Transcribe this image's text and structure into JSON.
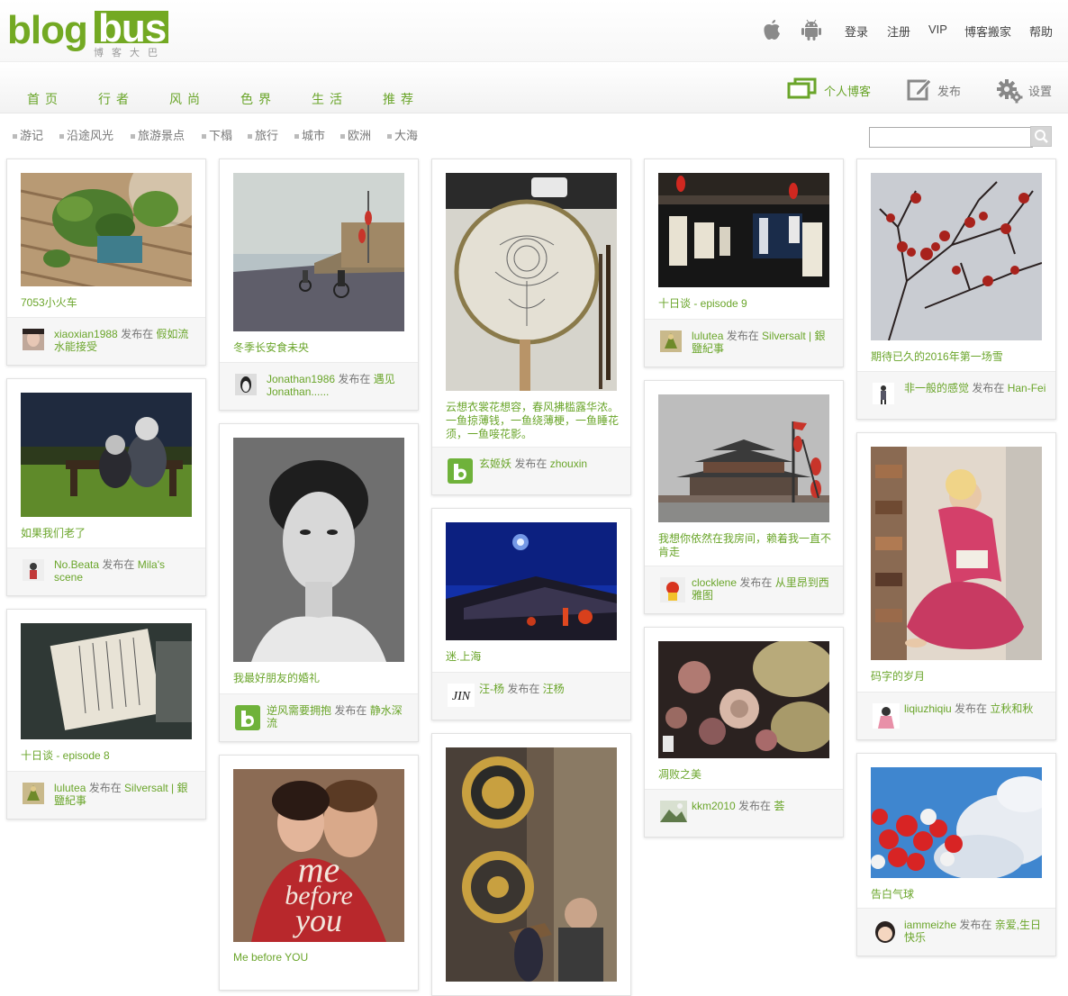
{
  "header": {
    "logo_main": "blog",
    "logo_bus": "bus",
    "logo_sub": "博客大巴",
    "links": [
      "登录",
      "注册",
      "VIP",
      "博客搬家",
      "帮助"
    ],
    "platform_icons": [
      "apple-icon",
      "android-icon"
    ]
  },
  "nav": {
    "items": [
      "首页",
      "行者",
      "风尚",
      "色界",
      "生活",
      "推荐"
    ],
    "tools": [
      {
        "label": "个人博客",
        "icon": "personal-blog-icon"
      },
      {
        "label": "发布",
        "icon": "edit-icon"
      },
      {
        "label": "设置",
        "icon": "gear-icon"
      }
    ]
  },
  "tags": [
    "游记",
    "沿途风光",
    "旅游景点",
    "下榻",
    "旅行",
    "城市",
    "欧洲",
    "大海"
  ],
  "search": {
    "placeholder": "",
    "button_icon": "search-icon"
  },
  "colors": {
    "accent": "#6aa52a",
    "logo": "#73a923"
  },
  "posts": [
    {
      "title": "7053小火车",
      "user": "xiaoxian1988",
      "verb": " 发布在 ",
      "blog": "假如流水能接受"
    },
    {
      "title": "如果我们老了",
      "user": "No.Beata",
      "verb": " 发布在 ",
      "blog": "Mila's scene"
    },
    {
      "title": "十日谈 - episode 8",
      "user": "lulutea",
      "verb": " 发布在 ",
      "blog": "Silversalt | 銀鹽紀事"
    },
    {
      "title": "冬季长安食未央",
      "user": "Jonathan1986",
      "verb": " 发布在 ",
      "blog": "遇见Jonathan......"
    },
    {
      "title": "我最好朋友的婚礼",
      "user": "逆风需要拥抱",
      "verb": " 发布在 ",
      "blog": "静水深流"
    },
    {
      "title": "Me before YOU",
      "user": "",
      "verb": "",
      "blog": ""
    },
    {
      "title": "云想衣裳花想容，春风拂槛露华浓。一鱼掠薄钱，一鱼绕薄梗，一鱼睡花须，一鱼唼花影。",
      "user": "玄姬妖",
      "verb": " 发布在 ",
      "blog": "zhouxin"
    },
    {
      "title": "迷.上海",
      "user": "汪-杨",
      "verb": " 发布在 ",
      "blog": "汪杨"
    },
    {
      "title": "",
      "user": "",
      "verb": "",
      "blog": ""
    },
    {
      "title": "十日谈 - episode 9",
      "user": "lulutea",
      "verb": " 发布在 ",
      "blog": "Silversalt | 銀鹽紀事"
    },
    {
      "title": "我想你依然在我房间，赖着我一直不肯走",
      "user": "clocklene",
      "verb": " 发布在 ",
      "blog": "从里昂到西雅图"
    },
    {
      "title": "凋败之美",
      "user": "kkm2010",
      "verb": " 发布在 ",
      "blog": "荟"
    },
    {
      "title": "期待已久的2016年第一场雪",
      "user": "非一般的感觉",
      "verb": " 发布在 ",
      "blog": "Han-Fei"
    },
    {
      "title": "码字的岁月",
      "user": "liqiuzhiqiu",
      "verb": " 发布在 ",
      "blog": "立秋和秋"
    },
    {
      "title": "告白气球",
      "user": "iammeizhe",
      "verb": " 发布在 ",
      "blog": "亲爱,生日快乐"
    }
  ],
  "photo_captions": {
    "movie_poster": "me before you",
    "avatar_jin": "JIN"
  }
}
